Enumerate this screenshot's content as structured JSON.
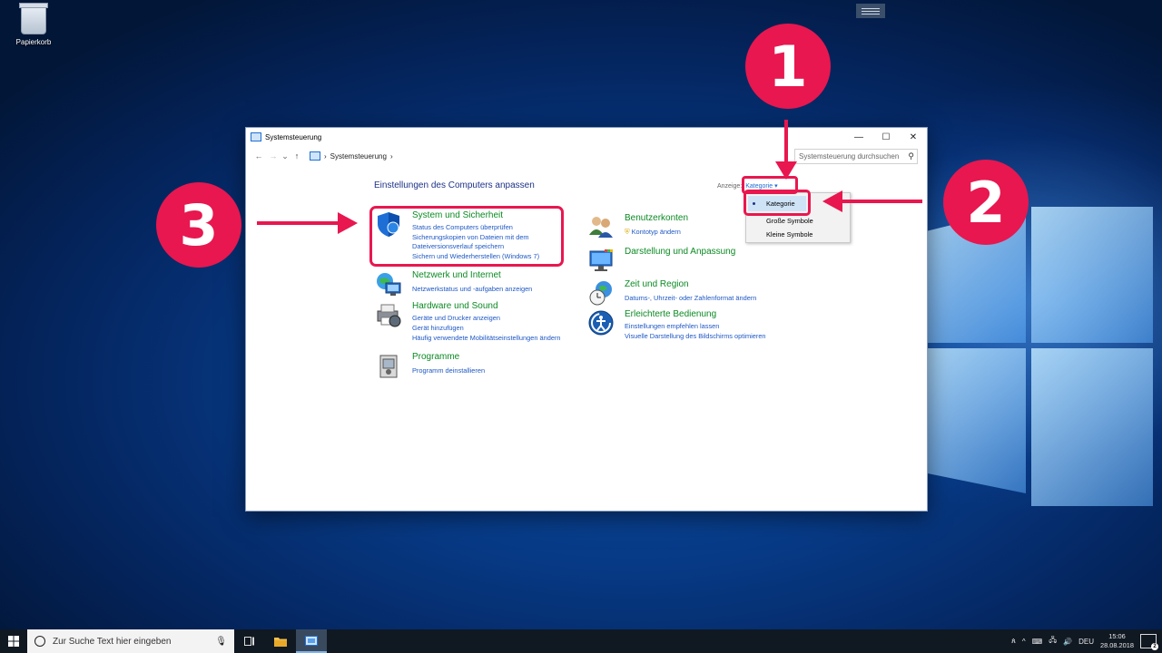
{
  "desktop": {
    "recycle_bin_label": "Papierkorb"
  },
  "window": {
    "title": "Systemsteuerung",
    "controls": {
      "minimize": "—",
      "maximize": "☐",
      "close": "✕"
    },
    "nav": {
      "back": "←",
      "forward": "→",
      "recent": "⌄",
      "up": "↑"
    },
    "address": {
      "separator": "›",
      "path": "Systemsteuerung",
      "trail": "›"
    },
    "search_placeholder": "Systemsteuerung durchsuchen"
  },
  "content": {
    "title": "Einstellungen des Computers anpassen",
    "view_label": "Anzeige:",
    "view_value": "Kategorie ▾",
    "left_categories": [
      {
        "title": "System und Sicherheit",
        "icon": "shield-icon",
        "links": [
          "Status des Computers überprüfen",
          "Sicherungskopien von Dateien mit dem",
          "Dateiversionsverlauf speichern",
          "Sichern und Wiederherstellen (Windows 7)"
        ]
      },
      {
        "title": "Netzwerk und Internet",
        "icon": "network-icon",
        "links": [
          "Netzwerkstatus und -aufgaben anzeigen"
        ]
      },
      {
        "title": "Hardware und Sound",
        "icon": "printer-icon",
        "links": [
          "Geräte und Drucker anzeigen",
          "Gerät hinzufügen",
          "Häufig verwendete Mobilitätseinstellungen ändern"
        ]
      },
      {
        "title": "Programme",
        "icon": "programs-icon",
        "links": [
          "Programm deinstallieren"
        ]
      }
    ],
    "right_categories": [
      {
        "title": "Benutzerkonten",
        "icon": "users-icon",
        "links": [
          "Kontotyp ändern"
        ]
      },
      {
        "title": "Darstellung und Anpassung",
        "icon": "display-icon",
        "links": []
      },
      {
        "title": "Zeit und Region",
        "icon": "clock-globe-icon",
        "links": [
          "Datums-, Uhrzeit- oder Zahlenformat ändern"
        ]
      },
      {
        "title": "Erleichterte Bedienung",
        "icon": "accessibility-icon",
        "links": [
          "Einstellungen empfehlen lassen",
          "Visuelle Darstellung des Bildschirms optimieren"
        ]
      }
    ]
  },
  "dropdown": {
    "options": [
      "Kategorie",
      "Große Symbole",
      "Kleine Symbole"
    ],
    "selected": "Kategorie"
  },
  "annotations": {
    "step1": "1",
    "step2": "2",
    "step3": "3"
  },
  "taskbar": {
    "search_placeholder": "Zur Suche Text hier eingeben",
    "language": "DEU",
    "time": "15:06",
    "date": "28.08.2018",
    "notification_count": "2"
  },
  "colors": {
    "accent": "#e8174f",
    "link": "#1e58c4",
    "category_title": "#0b8a23",
    "heading": "#1e3287"
  }
}
